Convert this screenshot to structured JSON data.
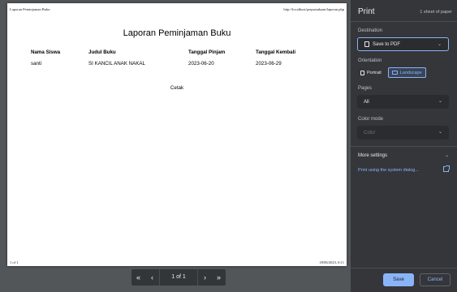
{
  "preview": {
    "header_left": "Laporan Peminjaman Buku",
    "header_right": "http://localhost/perpustakaan/laporan.php",
    "footer_left": "1 of 1",
    "footer_right": "18/06/2023, 0:11",
    "title": "Laporan Peminjaman Buku",
    "columns": [
      "Nama Siswa",
      "Judul Buku",
      "Tanggal Pinjam",
      "Tanggal Kembali"
    ],
    "rows": [
      [
        "santi",
        "SI KANCIL ANAK NAKAL",
        "2023-06-20",
        "2023-06-29"
      ]
    ],
    "cetak": "Cetak"
  },
  "pager": {
    "first": "«",
    "prev": "‹",
    "label": "1 of 1",
    "next": "›",
    "last": "»"
  },
  "sidebar": {
    "title": "Print",
    "sheet_count": "1 sheet of paper",
    "destination_label": "Destination",
    "destination_value": "Save to PDF",
    "orientation_label": "Orientation",
    "portrait": "Portrait",
    "landscape": "Landscape",
    "pages_label": "Pages",
    "pages_value": "All",
    "color_label": "Color mode",
    "color_value": "Color",
    "more_settings": "More settings",
    "system_dialog": "Print using the system dialog...",
    "save": "Save",
    "cancel": "Cancel",
    "accent": "#8ab4f8"
  }
}
